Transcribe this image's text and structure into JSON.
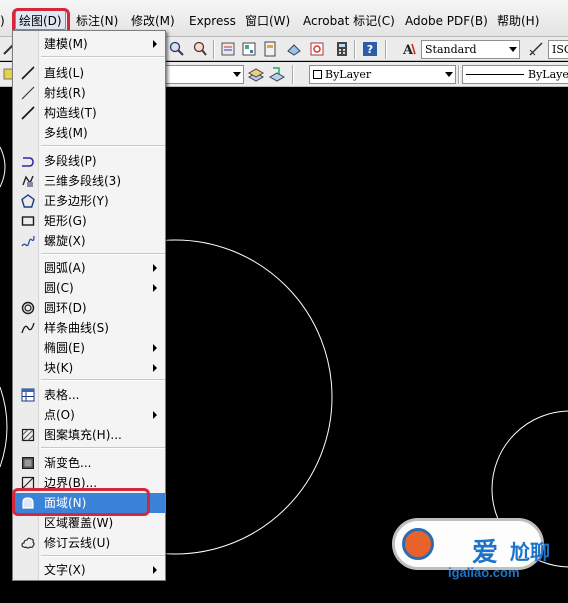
{
  "menubar": {
    "items": [
      {
        "label": ")"
      },
      {
        "label": "绘图(D)"
      },
      {
        "label": "标注(N)"
      },
      {
        "label": "修改(M)"
      },
      {
        "label": "Express"
      },
      {
        "label": "窗口(W)"
      },
      {
        "label": "Acrobat 标记(C)"
      },
      {
        "label": "Adobe PDF(B)"
      },
      {
        "label": "帮助(H)"
      }
    ]
  },
  "toolbar": {
    "text_style": "Standard",
    "dim_style": "ISO",
    "layer_color": "ByLayer",
    "linetype": "ByLayer"
  },
  "draw_menu": {
    "items": [
      {
        "label": "建模(M)"
      },
      {
        "label": "直线(L)"
      },
      {
        "label": "射线(R)"
      },
      {
        "label": "构造线(T)"
      },
      {
        "label": "多线(M)"
      },
      {
        "label": "多段线(P)"
      },
      {
        "label": "三维多段线(3)"
      },
      {
        "label": "正多边形(Y)"
      },
      {
        "label": "矩形(G)"
      },
      {
        "label": "螺旋(X)"
      },
      {
        "label": "圆弧(A)"
      },
      {
        "label": "圆(C)"
      },
      {
        "label": "圆环(D)"
      },
      {
        "label": "样条曲线(S)"
      },
      {
        "label": "椭圆(E)"
      },
      {
        "label": "块(K)"
      },
      {
        "label": "表格..."
      },
      {
        "label": "点(O)"
      },
      {
        "label": "图案填充(H)..."
      },
      {
        "label": "渐变色..."
      },
      {
        "label": "边界(B)..."
      },
      {
        "label": "面域(N)"
      },
      {
        "label": "区域覆盖(W)"
      },
      {
        "label": "修订云线(U)"
      },
      {
        "label": "文字(X)"
      }
    ]
  },
  "watermark": {
    "main": "爱",
    "main2": "尬聊",
    "url": "igaliao.com"
  },
  "colors": {
    "highlight": "#3b83d8",
    "annotation": "#d6263a",
    "canvas": "#000000"
  }
}
